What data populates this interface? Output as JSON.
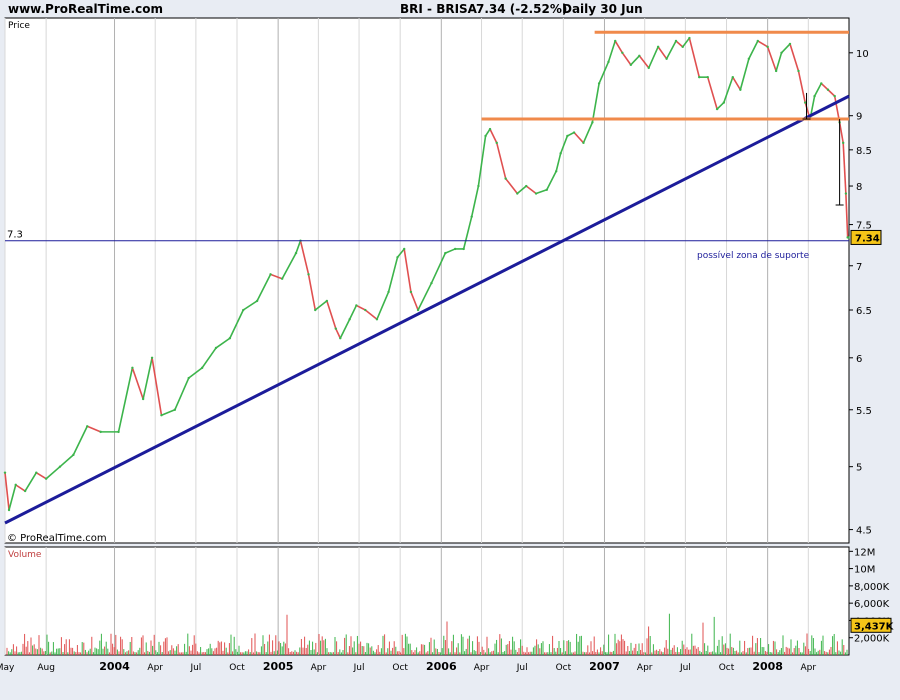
{
  "header": {
    "site": "www.ProRealTime.com",
    "instrument": "BRI - BRISA",
    "price_change": "7.34 (-2.52%)",
    "period": "Daily  30 Jun"
  },
  "price_panel": {
    "label": "Price",
    "watermark": "© ProRealTime.com",
    "level_label": "7.3",
    "last_price_badge": "7.34",
    "annotation": "possível zona de suporte"
  },
  "volume_panel": {
    "label": "Volume",
    "last_volume_badge": "3,437K"
  },
  "colors": {
    "background": "#e8ecf3",
    "plot_bg": "#ffffff",
    "up": "#3cb44b",
    "down": "#e05050",
    "trendline": "#1c1c9a",
    "resistance": "#f08a4b",
    "badge": "#f5c518"
  },
  "chart_data": {
    "type": "line",
    "instrument": "BRI - BRISA",
    "last_price": 7.34,
    "change_pct": -2.52,
    "y_scale": "log",
    "ylim": [
      4.4,
      10.6
    ],
    "y_ticks": [
      {
        "value": 10,
        "label": "10"
      },
      {
        "value": 9,
        "label": "9"
      },
      {
        "value": 8.5,
        "label": "8.5"
      },
      {
        "value": 8,
        "label": "8"
      },
      {
        "value": 7.5,
        "label": "7.5"
      },
      {
        "value": 7,
        "label": "7"
      },
      {
        "value": 6.5,
        "label": "6.5"
      },
      {
        "value": 6,
        "label": "6"
      },
      {
        "value": 5.5,
        "label": "5.5"
      },
      {
        "value": 5,
        "label": "5"
      },
      {
        "value": 4.5,
        "label": "4.5"
      }
    ],
    "xlim": [
      "2003-05-01",
      "2008-07-01"
    ],
    "x_ticks": [
      {
        "date": "2003-05-01",
        "label": "May",
        "major": false
      },
      {
        "date": "2003-08-01",
        "label": "Aug",
        "major": false
      },
      {
        "date": "2004-01-01",
        "label": "2004",
        "major": true
      },
      {
        "date": "2004-04-01",
        "label": "Apr",
        "major": false
      },
      {
        "date": "2004-07-01",
        "label": "Jul",
        "major": false
      },
      {
        "date": "2004-10-01",
        "label": "Oct",
        "major": false
      },
      {
        "date": "2005-01-01",
        "label": "2005",
        "major": true
      },
      {
        "date": "2005-04-01",
        "label": "Apr",
        "major": false
      },
      {
        "date": "2005-07-01",
        "label": "Jul",
        "major": false
      },
      {
        "date": "2005-10-01",
        "label": "Oct",
        "major": false
      },
      {
        "date": "2006-01-01",
        "label": "2006",
        "major": true
      },
      {
        "date": "2006-04-01",
        "label": "Apr",
        "major": false
      },
      {
        "date": "2006-07-01",
        "label": "Jul",
        "major": false
      },
      {
        "date": "2006-10-01",
        "label": "Oct",
        "major": false
      },
      {
        "date": "2007-01-01",
        "label": "2007",
        "major": true
      },
      {
        "date": "2007-04-01",
        "label": "Apr",
        "major": false
      },
      {
        "date": "2007-07-01",
        "label": "Jul",
        "major": false
      },
      {
        "date": "2007-10-01",
        "label": "Oct",
        "major": false
      },
      {
        "date": "2008-01-01",
        "label": "2008",
        "major": true
      },
      {
        "date": "2008-04-01",
        "label": "Apr",
        "major": false
      }
    ],
    "series": [
      {
        "points": [
          [
            "2003-05-01",
            4.95
          ],
          [
            "2003-05-10",
            4.65
          ],
          [
            "2003-05-25",
            4.85
          ],
          [
            "2003-06-15",
            4.8
          ],
          [
            "2003-07-10",
            4.95
          ],
          [
            "2003-08-01",
            4.9
          ],
          [
            "2003-09-01",
            5.0
          ],
          [
            "2003-10-01",
            5.1
          ],
          [
            "2003-11-01",
            5.35
          ],
          [
            "2003-12-01",
            5.3
          ],
          [
            "2004-01-10",
            5.3
          ],
          [
            "2004-02-10",
            5.9
          ],
          [
            "2004-03-05",
            5.6
          ],
          [
            "2004-03-25",
            6.0
          ],
          [
            "2004-04-15",
            5.45
          ],
          [
            "2004-05-15",
            5.5
          ],
          [
            "2004-06-15",
            5.8
          ],
          [
            "2004-07-15",
            5.9
          ],
          [
            "2004-08-15",
            6.1
          ],
          [
            "2004-09-15",
            6.2
          ],
          [
            "2004-10-15",
            6.5
          ],
          [
            "2004-11-15",
            6.6
          ],
          [
            "2004-12-15",
            6.9
          ],
          [
            "2005-01-10",
            6.85
          ],
          [
            "2005-02-10",
            7.15
          ],
          [
            "2005-02-20",
            7.3
          ],
          [
            "2005-03-10",
            6.9
          ],
          [
            "2005-03-25",
            6.5
          ],
          [
            "2005-04-20",
            6.6
          ],
          [
            "2005-05-10",
            6.3
          ],
          [
            "2005-05-20",
            6.2
          ],
          [
            "2005-06-10",
            6.4
          ],
          [
            "2005-06-25",
            6.55
          ],
          [
            "2005-07-15",
            6.5
          ],
          [
            "2005-08-10",
            6.4
          ],
          [
            "2005-09-05",
            6.7
          ],
          [
            "2005-09-25",
            7.1
          ],
          [
            "2005-10-10",
            7.2
          ],
          [
            "2005-10-25",
            6.7
          ],
          [
            "2005-11-10",
            6.5
          ],
          [
            "2005-12-10",
            6.8
          ],
          [
            "2006-01-10",
            7.15
          ],
          [
            "2006-02-01",
            7.2
          ],
          [
            "2006-02-20",
            7.2
          ],
          [
            "2006-03-10",
            7.6
          ],
          [
            "2006-03-25",
            8.0
          ],
          [
            "2006-04-10",
            8.7
          ],
          [
            "2006-04-20",
            8.8
          ],
          [
            "2006-05-05",
            8.6
          ],
          [
            "2006-05-25",
            8.1
          ],
          [
            "2006-06-20",
            7.9
          ],
          [
            "2006-07-10",
            8.0
          ],
          [
            "2006-08-01",
            7.9
          ],
          [
            "2006-08-25",
            7.95
          ],
          [
            "2006-09-15",
            8.2
          ],
          [
            "2006-09-25",
            8.45
          ],
          [
            "2006-10-10",
            8.7
          ],
          [
            "2006-10-25",
            8.75
          ],
          [
            "2006-11-15",
            8.6
          ],
          [
            "2006-12-05",
            8.9
          ],
          [
            "2006-12-20",
            9.5
          ],
          [
            "2007-01-10",
            9.85
          ],
          [
            "2007-01-25",
            10.2
          ],
          [
            "2007-02-10",
            10.0
          ],
          [
            "2007-03-01",
            9.8
          ],
          [
            "2007-03-20",
            9.95
          ],
          [
            "2007-04-10",
            9.75
          ],
          [
            "2007-05-01",
            10.1
          ],
          [
            "2007-05-20",
            9.9
          ],
          [
            "2007-06-10",
            10.2
          ],
          [
            "2007-06-25",
            10.1
          ],
          [
            "2007-07-10",
            10.25
          ],
          [
            "2007-08-01",
            9.6
          ],
          [
            "2007-08-20",
            9.6
          ],
          [
            "2007-09-10",
            9.1
          ],
          [
            "2007-09-25",
            9.2
          ],
          [
            "2007-10-15",
            9.6
          ],
          [
            "2007-11-01",
            9.4
          ],
          [
            "2007-11-20",
            9.9
          ],
          [
            "2007-12-10",
            10.2
          ],
          [
            "2008-01-01",
            10.1
          ],
          [
            "2008-01-20",
            9.7
          ],
          [
            "2008-02-01",
            10.0
          ],
          [
            "2008-02-20",
            10.15
          ],
          [
            "2008-03-10",
            9.7
          ],
          [
            "2008-03-25",
            9.2
          ],
          [
            "2008-04-05",
            8.95
          ],
          [
            "2008-04-15",
            9.3
          ],
          [
            "2008-04-30",
            9.5
          ],
          [
            "2008-05-15",
            9.4
          ],
          [
            "2008-05-30",
            9.3
          ],
          [
            "2008-06-10",
            8.9
          ],
          [
            "2008-06-18",
            8.6
          ],
          [
            "2008-06-24",
            7.9
          ],
          [
            "2008-06-28",
            7.34
          ],
          [
            "2008-06-30",
            7.34
          ]
        ]
      }
    ],
    "trendline": {
      "from": [
        "2003-05-01",
        4.55
      ],
      "to": [
        "2008-07-01",
        9.3
      ]
    },
    "resistance_lines": [
      {
        "from": "2006-04-01",
        "to": "2008-07-01",
        "value": 8.95
      },
      {
        "from": "2006-12-10",
        "to": "2008-07-01",
        "value": 10.35
      }
    ],
    "reference_line": {
      "value": 7.3
    },
    "markers": [
      {
        "date": "2008-06-10",
        "from": 8.95,
        "to": 7.75
      },
      {
        "date": "2008-03-28",
        "from": 9.35,
        "to": 8.95
      }
    ],
    "volume": {
      "ylim": [
        0,
        12500000
      ],
      "y_ticks": [
        {
          "value": 12000000,
          "label": "12M"
        },
        {
          "value": 10000000,
          "label": "10M"
        },
        {
          "value": 8000000,
          "label": "8,000K"
        },
        {
          "value": 6000000,
          "label": "6,000K"
        },
        {
          "value": 4000000,
          "label": "4,000K"
        },
        {
          "value": 2000000,
          "label": "2,000K"
        }
      ],
      "last": 3437000
    }
  }
}
